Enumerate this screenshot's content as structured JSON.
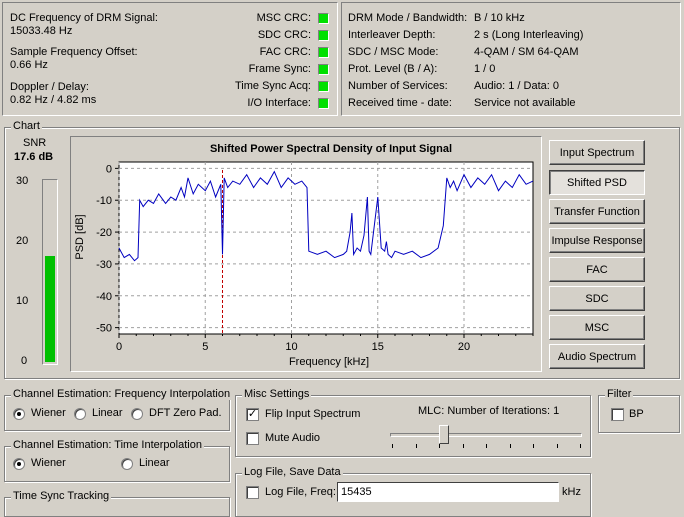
{
  "status_left": {
    "rows": [
      {
        "label": "DC Frequency of DRM Signal:",
        "value": "15033.48 Hz"
      },
      {
        "label": "Sample Frequency Offset:",
        "value": "0.66 Hz"
      },
      {
        "label": "Doppler / Delay:",
        "value": "0.82 Hz / 4.82 ms"
      }
    ],
    "indicators": [
      "MSC CRC:",
      "SDC CRC:",
      "FAC CRC:",
      "Frame Sync:",
      "Time Sync Acq:",
      "I/O Interface:"
    ],
    "led_color": "#00e000"
  },
  "status_right": {
    "labels": [
      "DRM Mode / Bandwidth:",
      "Interleaver Depth:",
      "SDC / MSC Mode:",
      "Prot. Level (B / A):",
      "Number of Services:",
      "Received time - date:"
    ],
    "values": [
      "B / 10 kHz",
      "2 s (Long Interleaving)",
      "4-QAM / SM 64-QAM",
      "1 / 0",
      "Audio: 1 / Data: 0",
      "Service not available"
    ]
  },
  "chart_group": {
    "title": "Chart",
    "snr_label": "SNR",
    "snr_value": "17.6 dB",
    "snr_ticks": [
      "30",
      "20",
      "10",
      "0"
    ],
    "snr_level": 17.6,
    "snr_max": 30
  },
  "chart_data": {
    "type": "line",
    "title": "Shifted Power Spectral Density of Input Signal",
    "xlabel": "Frequency [kHz]",
    "ylabel": "PSD [dB]",
    "xlim": [
      0,
      24
    ],
    "ylim": [
      -52,
      2
    ],
    "xticks": [
      "0",
      "5",
      "10",
      "15",
      "20"
    ],
    "yticks": [
      "0",
      "-10",
      "-20",
      "-30",
      "-40",
      "-50"
    ],
    "grid": true,
    "marker_x": 6.0,
    "series": [
      {
        "color": "#0000c0",
        "x": [
          0,
          0.3,
          0.6,
          0.9,
          1.1,
          1.2,
          1.4,
          1.7,
          2.0,
          2.3,
          2.7,
          3.0,
          3.3,
          3.6,
          3.8,
          4.0,
          4.3,
          4.6,
          5.0,
          5.3,
          5.6,
          5.9,
          6.0,
          6.1,
          6.3,
          6.6,
          7.0,
          7.4,
          7.8,
          8.2,
          8.6,
          9.0,
          9.4,
          9.8,
          10.2,
          10.6,
          10.9,
          11.0,
          11.5,
          12.0,
          12.5,
          13.0,
          13.2,
          13.4,
          13.5,
          13.6,
          13.8,
          14.0,
          14.2,
          14.4,
          14.5,
          14.6,
          14.8,
          15.0,
          15.2,
          15.4,
          15.5,
          15.6,
          15.8,
          16.0,
          16.5,
          17.0,
          17.5,
          18.0,
          18.5,
          18.8,
          19.0,
          19.2,
          19.4,
          19.6,
          20.0,
          20.4,
          20.8,
          21.2,
          21.6,
          22.0,
          22.4,
          22.8,
          23.2,
          23.6,
          24.0
        ],
        "y": [
          -25,
          -28,
          -27,
          -29,
          -28,
          -10,
          -12,
          -10,
          -11,
          -8,
          -11,
          -9,
          -10,
          -6,
          -9,
          -3,
          -8,
          -5,
          -7,
          -4,
          -9,
          -5,
          -27,
          -3,
          -6,
          -4,
          -5,
          -2,
          -6,
          -3,
          -5,
          -1,
          -6,
          -3,
          -5,
          -4,
          -6,
          -26,
          -27,
          -26,
          -28,
          -27,
          -26,
          -20,
          -14,
          -27,
          -25,
          -26,
          -21,
          -9,
          -26,
          -27,
          -18,
          -9,
          -25,
          -26,
          -23,
          -27,
          -28,
          -26,
          -27,
          -26,
          -28,
          -27,
          -25,
          -18,
          -3,
          -6,
          -4,
          -7,
          -2,
          -6,
          -3,
          -5,
          -2,
          -7,
          -4,
          -6,
          -2,
          -5,
          -4
        ]
      }
    ]
  },
  "chart_buttons": [
    "Input Spectrum",
    "Shifted PSD",
    "Transfer Function",
    "Impulse Response",
    "FAC",
    "SDC",
    "MSC",
    "Audio Spectrum"
  ],
  "channel_freq": {
    "title": "Channel Estimation: Frequency Interpolation",
    "options": [
      "Wiener",
      "Linear",
      "DFT Zero Pad."
    ],
    "selected": 0
  },
  "channel_time": {
    "title": "Channel Estimation: Time Interpolation",
    "options": [
      "Wiener",
      "Linear"
    ],
    "selected": 0
  },
  "time_sync": {
    "title": "Time Sync Tracking"
  },
  "misc": {
    "title": "Misc Settings",
    "flip_label": "Flip Input Spectrum",
    "flip_checked": "✓",
    "mute_label": "Mute Audio",
    "mlc_label": "MLC: Number of Iterations: 1",
    "mlc_fraction": 0.2
  },
  "filter": {
    "title": "Filter",
    "bp_label": "BP"
  },
  "logfile": {
    "title": "Log File, Save Data",
    "check_label": "Log File, Freq:",
    "freq_value": "15435",
    "unit": "kHz"
  }
}
